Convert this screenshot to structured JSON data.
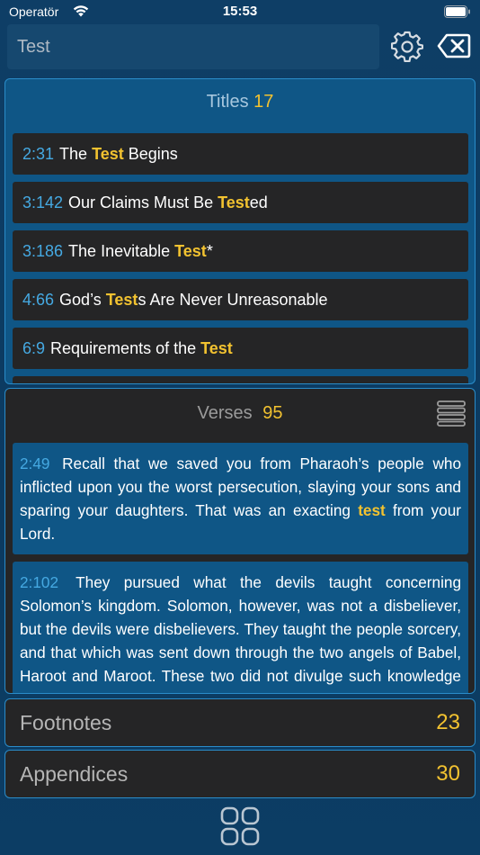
{
  "status_bar": {
    "carrier": "Operatör",
    "time": "15:53"
  },
  "search": {
    "value": "Test"
  },
  "titles": {
    "label": "Titles",
    "count": "17",
    "items": [
      {
        "ref": "2:31",
        "pre": "The ",
        "hl": "Test",
        "post": " Begins"
      },
      {
        "ref": "3:142",
        "pre": "Our Claims Must Be ",
        "hl": "Test",
        "post": "ed"
      },
      {
        "ref": "3:186",
        "pre": "The Inevitable ",
        "hl": "Test",
        "post": "*"
      },
      {
        "ref": "4:66",
        "pre": "God’s ",
        "hl": "Test",
        "post": "s Are Never Unreasonable"
      },
      {
        "ref": "6:9",
        "pre": "Requirements of the ",
        "hl": "Test",
        "post": ""
      }
    ]
  },
  "verses": {
    "label": "Verses",
    "count": "95",
    "items": [
      {
        "ref": "2:49",
        "pre": "Recall that we saved you from Pharaoh’s people who inflicted upon you the worst persecution, slaying your sons and sparing your daughters. That was an exacting ",
        "hl": "test",
        "post": " from your Lord."
      },
      {
        "ref": "2:102",
        "pre": "They pursued what the devils taught concerning Solomon’s kingdom. Solomon, however, was not a disbe­liever, but the devils were disbelievers. They taught the people sorcery, and that which was sent down through the two angels of Babel, Haroot and Maroot. These two did not divulge such knowledge without pointing out: “This is a test. You shall not abuse such knowledge.”",
        "hl": "",
        "post": ""
      }
    ]
  },
  "footnotes": {
    "label": "Footnotes",
    "count": "23"
  },
  "appendices": {
    "label": "Appendices",
    "count": "30"
  },
  "colors": {
    "background": "#0d3d63",
    "panel_blue": "#0f5686",
    "panel_dark": "#252526",
    "border": "#2a8cc9",
    "reference": "#45a9e2",
    "highlight": "#f2c230"
  },
  "icons": {
    "settings": "gear-icon",
    "clear": "clear-backspace-icon",
    "list": "list-lines-icon",
    "grid": "grid-four-squares-icon"
  }
}
